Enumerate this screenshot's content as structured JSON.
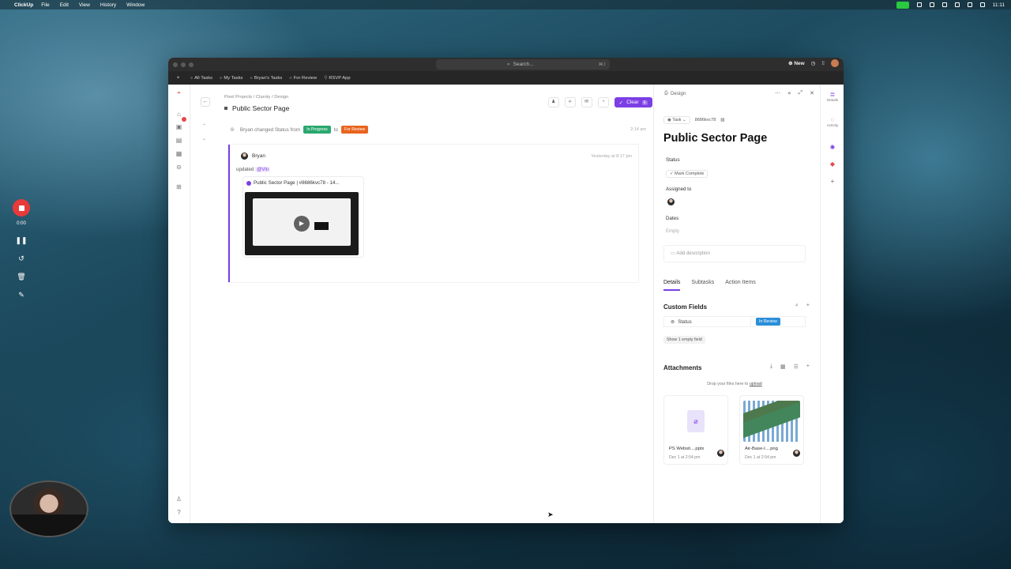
{
  "menubar": {
    "app": "ClickUp",
    "items": [
      "File",
      "Edit",
      "View",
      "History",
      "Window"
    ],
    "clock": "11:11"
  },
  "recorder": {
    "time": "0:00"
  },
  "window": {
    "search_placeholder": "Search...",
    "search_shortcut": "⌘J",
    "new_label": "New",
    "favorites": [
      "All Tasks",
      "My Tasks",
      "Bryan's Tasks",
      "For Review",
      "RSVP App"
    ]
  },
  "main": {
    "breadcrumb": [
      "Pixel Projects",
      "Claroty",
      "Design"
    ],
    "title": "Public Sector Page",
    "clear_label": "Clear",
    "clear_key": "E",
    "status_change": {
      "text": "Bryan changed Status from",
      "from": "In Progress",
      "to_word": "to",
      "to": "For Review",
      "time": "2:14 am"
    },
    "comment": {
      "user": "Bryan",
      "time": "Yesterday at 8:17 pm",
      "action": "updated",
      "mention": "@Vin",
      "attachment_title": "Public Sector Page | #8686kvc78 - 14..."
    }
  },
  "panel": {
    "location": "Design",
    "task_type": "Task",
    "task_id": "8686kvc78",
    "title": "Public Sector Page",
    "status_label": "Status",
    "mark_complete": "Mark Complete",
    "assigned_label": "Assigned to",
    "dates_label": "Dates",
    "dates_value": "Empty",
    "description_placeholder": "Add description",
    "tabs": [
      "Details",
      "Subtasks",
      "Action Items"
    ],
    "custom_fields_title": "Custom Fields",
    "custom_field": {
      "label": "Status",
      "value": "In Review"
    },
    "show_empty": "Show 1 empty field",
    "attachments_title": "Attachments",
    "drop_text": "Drop your files here to",
    "drop_link": "upload",
    "files": [
      {
        "name": "PS Websit....pptx",
        "date": "Dec 1 at 2:54 pm"
      },
      {
        "name": "Air-Base-I....png",
        "date": "Dec 1 at 2:54 pm"
      }
    ]
  },
  "rightrail": {
    "details": "Details",
    "activity": "Activity"
  },
  "colors": {
    "accent": "#7b3fe4",
    "in_progress": "#2aa86f",
    "for_review": "#e8641f",
    "in_review": "#2a8fd8"
  }
}
